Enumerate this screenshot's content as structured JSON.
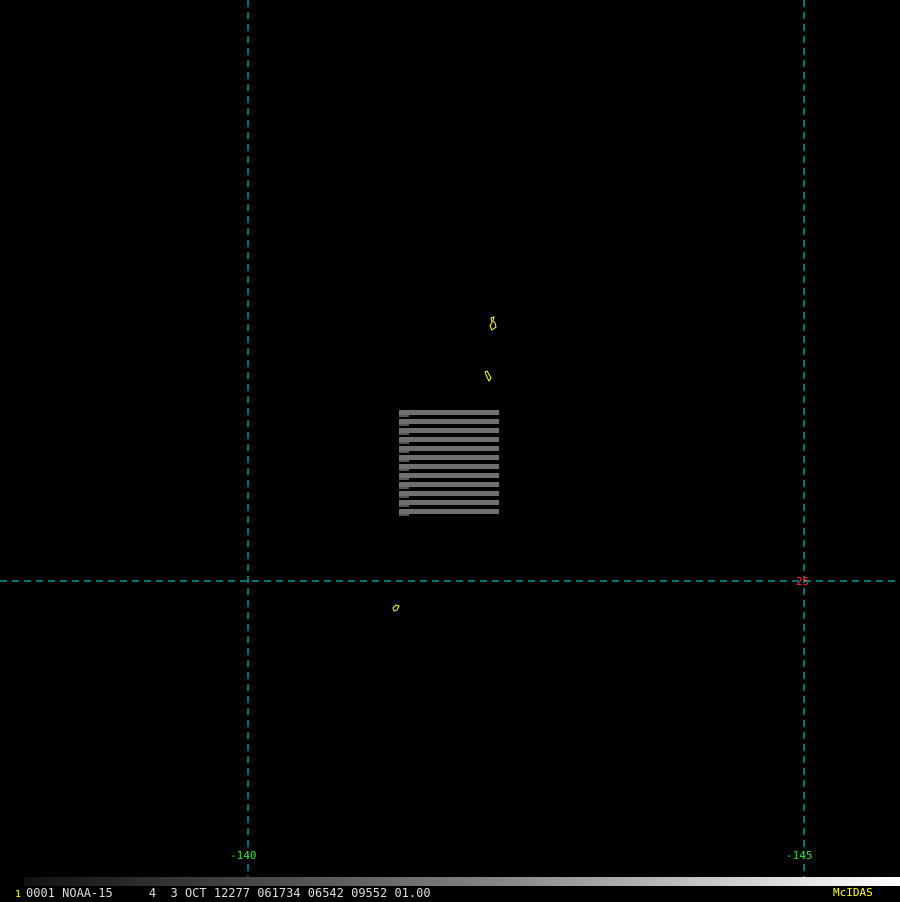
{
  "map": {
    "lon_labels": [
      "-140",
      "-145"
    ],
    "lat_labels": [
      "25"
    ],
    "colors": {
      "background": "#000000",
      "grid_lines": "#00e5e5",
      "lon_label": "#33dd33",
      "lat_label": "#ff3333",
      "coastline": "#ffff33",
      "data_block": "#6f6f6f"
    }
  },
  "status": {
    "frame_number": "1",
    "info": "0001 NOAA-15     4  3 OCT 12277 061734 06542 09552 01.00",
    "brand": "McIDAS",
    "colors": {
      "frame_number": "#ffff33",
      "info": "#dddddd",
      "brand": "#ffff33"
    }
  }
}
